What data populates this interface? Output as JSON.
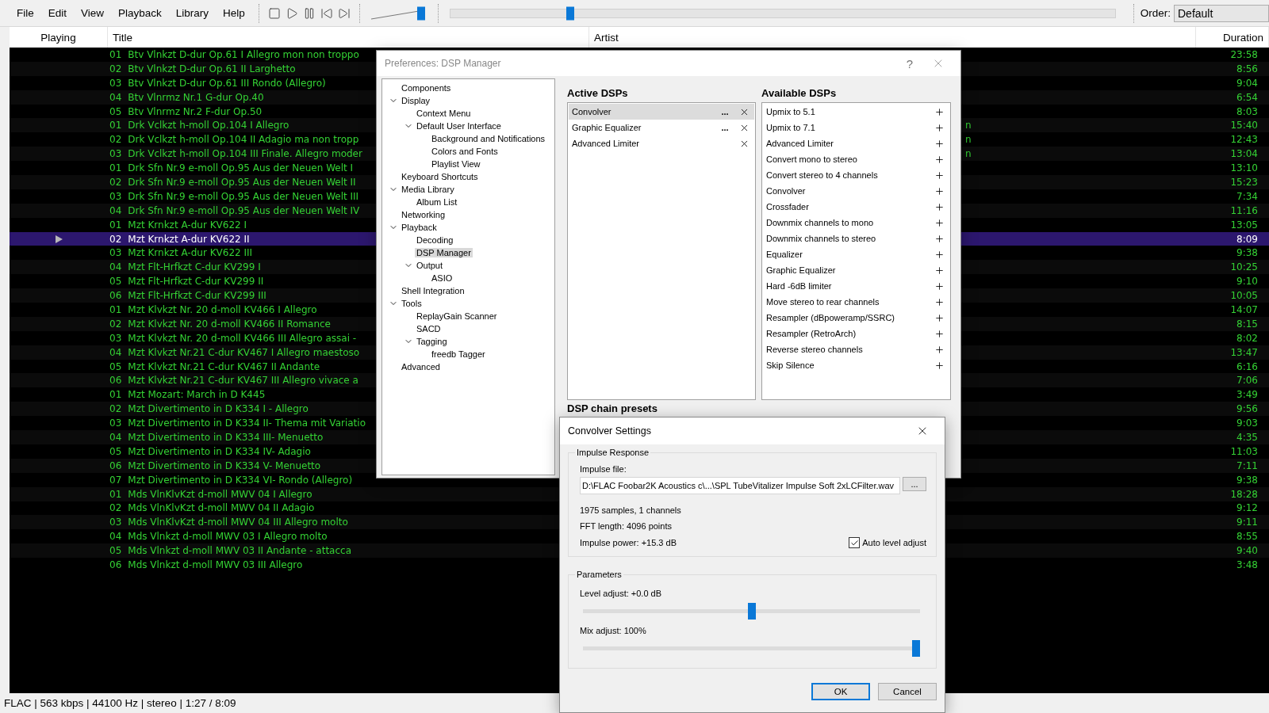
{
  "menu": [
    "File",
    "Edit",
    "View",
    "Playback",
    "Library",
    "Help"
  ],
  "toolbar": {
    "volume": {
      "level": 0.9
    },
    "seek": {
      "level": 0.18
    },
    "order_label": "Order:",
    "order_value": "Default"
  },
  "playlist": {
    "columns": [
      "Playing",
      "Title",
      "Artist",
      "Duration"
    ],
    "rows": [
      {
        "track": "01",
        "title": "Btv Vlnkzt D-dur Op.61 I Allegro mon non troppo",
        "duration": "23:58",
        "playing": false
      },
      {
        "track": "02",
        "title": "Btv Vlnkzt D-dur Op.61 II Larghetto",
        "duration": "8:56",
        "playing": false
      },
      {
        "track": "03",
        "title": "Btv Vlnkzt D-dur Op.61 III Rondo (Allegro)",
        "duration": "9:04",
        "playing": false
      },
      {
        "track": "04",
        "title": "Btv Vlnrmz Nr.1 G-dur Op.40",
        "duration": "6:54",
        "playing": false
      },
      {
        "track": "05",
        "title": "Btv Vlnrmz Nr.2 F-dur Op.50",
        "duration": "8:03",
        "playing": false
      },
      {
        "track": "01",
        "title": "Drk Vclkzt h-moll Op.104 I Allegro",
        "tail": "n",
        "duration": "15:40",
        "playing": false
      },
      {
        "track": "02",
        "title": "Drk Vclkzt h-moll Op.104 II Adagio ma non tropp",
        "tail": "n",
        "duration": "12:43",
        "playing": false
      },
      {
        "track": "03",
        "title": "Drk Vclkzt h-moll Op.104 III Finale. Allegro moder",
        "tail": "n",
        "duration": "13:04",
        "playing": false
      },
      {
        "track": "01",
        "title": "Drk Sfn Nr.9 e-moll Op.95 Aus der Neuen Welt I",
        "duration": "13:10",
        "playing": false
      },
      {
        "track": "02",
        "title": "Drk Sfn Nr.9 e-moll Op.95 Aus der Neuen Welt II",
        "duration": "15:23",
        "playing": false
      },
      {
        "track": "03",
        "title": "Drk Sfn Nr.9 e-moll Op.95 Aus der Neuen Welt III",
        "duration": "7:34",
        "playing": false
      },
      {
        "track": "04",
        "title": "Drk Sfn Nr.9 e-moll Op.95 Aus der Neuen Welt IV",
        "duration": "11:16",
        "playing": false
      },
      {
        "track": "01",
        "title": "Mzt Krnkzt A-dur KV622 I",
        "duration": "13:05",
        "playing": false
      },
      {
        "track": "02",
        "title": "Mzt Krnkzt A-dur KV622 II",
        "duration": "8:09",
        "playing": true
      },
      {
        "track": "03",
        "title": "Mzt Krnkzt A-dur KV622 III",
        "duration": "9:38",
        "playing": false
      },
      {
        "track": "04",
        "title": "Mzt Flt-Hrfkzt C-dur KV299 I",
        "duration": "10:25",
        "playing": false
      },
      {
        "track": "05",
        "title": "Mzt Flt-Hrfkzt C-dur KV299 II",
        "duration": "9:10",
        "playing": false
      },
      {
        "track": "06",
        "title": "Mzt Flt-Hrfkzt C-dur KV299 III",
        "duration": "10:05",
        "playing": false
      },
      {
        "track": "01",
        "title": "Mzt Klvkzt Nr. 20 d-moll KV466 I Allegro",
        "duration": "14:07",
        "playing": false
      },
      {
        "track": "02",
        "title": "Mzt Klvkzt Nr. 20 d-moll KV466 II Romance",
        "duration": "8:15",
        "playing": false
      },
      {
        "track": "03",
        "title": "Mzt Klvkzt Nr. 20 d-moll KV466 III Allegro assai -",
        "duration": "8:02",
        "playing": false
      },
      {
        "track": "04",
        "title": "Mzt Klvkzt Nr.21 C-dur KV467 I Allegro maestoso",
        "duration": "13:47",
        "playing": false
      },
      {
        "track": "05",
        "title": "Mzt Klvkzt Nr.21 C-dur KV467 II Andante",
        "duration": "6:16",
        "playing": false
      },
      {
        "track": "06",
        "title": "Mzt Klvkzt Nr.21 C-dur KV467 III Allegro vivace a",
        "duration": "7:06",
        "playing": false
      },
      {
        "track": "01",
        "title": "Mzt Mozart: March in D K445",
        "duration": "3:49",
        "playing": false
      },
      {
        "track": "02",
        "title": "Mzt Divertimento in D K334 I - Allegro",
        "duration": "9:56",
        "playing": false
      },
      {
        "track": "03",
        "title": "Mzt Divertimento in D K334 II- Thema mit Variatio",
        "duration": "9:03",
        "playing": false
      },
      {
        "track": "04",
        "title": "Mzt Divertimento in D K334 III- Menuetto",
        "duration": "4:35",
        "playing": false
      },
      {
        "track": "05",
        "title": "Mzt Divertimento in D K334 IV- Adagio",
        "duration": "11:03",
        "playing": false
      },
      {
        "track": "06",
        "title": "Mzt Divertimento in D K334 V- Menuetto",
        "duration": "7:11",
        "playing": false
      },
      {
        "track": "07",
        "title": "Mzt Divertimento in D K334 VI- Rondo (Allegro)",
        "duration": "9:38",
        "playing": false
      },
      {
        "track": "01",
        "title": "Mds VlnKlvKzt d-moll MWV 04 I Allegro",
        "duration": "18:28",
        "playing": false
      },
      {
        "track": "02",
        "title": "Mds VlnKlvKzt d-moll MWV 04 II Adagio",
        "duration": "9:12",
        "playing": false
      },
      {
        "track": "03",
        "title": "Mds VlnKlvKzt d-moll MWV 04 III Allegro molto",
        "duration": "9:11",
        "playing": false
      },
      {
        "track": "04",
        "title": "Mds Vlnkzt d-moll MWV 03 I Allegro molto",
        "duration": "8:55",
        "playing": false
      },
      {
        "track": "05",
        "title": "Mds Vlnkzt d-moll MWV 03 II Andante - attacca",
        "duration": "9:40",
        "playing": false
      },
      {
        "track": "06",
        "title": "Mds Vlnkzt d-moll MWV 03 III Allegro",
        "duration": "3:48",
        "playing": false
      }
    ]
  },
  "preferences": {
    "title": "Preferences: DSP Manager",
    "help": "?",
    "tree": [
      {
        "label": "Components",
        "selected": false
      },
      {
        "label": "Display",
        "selected": false,
        "expanded": true,
        "children": [
          {
            "label": "Context Menu",
            "selected": false
          },
          {
            "label": "Default User Interface",
            "selected": false,
            "expanded": true,
            "children": [
              {
                "label": "Background and Notifications",
                "selected": false
              },
              {
                "label": "Colors and Fonts",
                "selected": false
              },
              {
                "label": "Playlist View",
                "selected": false
              }
            ]
          }
        ]
      },
      {
        "label": "Keyboard Shortcuts",
        "selected": false
      },
      {
        "label": "Media Library",
        "selected": false,
        "expanded": true,
        "children": [
          {
            "label": "Album List",
            "selected": false
          }
        ]
      },
      {
        "label": "Networking",
        "selected": false
      },
      {
        "label": "Playback",
        "selected": false,
        "expanded": true,
        "children": [
          {
            "label": "Decoding",
            "selected": false
          },
          {
            "label": "DSP Manager",
            "selected": true
          },
          {
            "label": "Output",
            "selected": false,
            "expanded": true,
            "children": [
              {
                "label": "ASIO",
                "selected": false
              }
            ]
          }
        ]
      },
      {
        "label": "Shell Integration",
        "selected": false
      },
      {
        "label": "Tools",
        "selected": false,
        "expanded": true,
        "children": [
          {
            "label": "ReplayGain Scanner",
            "selected": false
          },
          {
            "label": "SACD",
            "selected": false
          },
          {
            "label": "Tagging",
            "selected": false,
            "expanded": true,
            "children": [
              {
                "label": "freedb Tagger",
                "selected": false
              }
            ]
          }
        ]
      },
      {
        "label": "Advanced",
        "selected": false
      }
    ],
    "active_heading": "Active DSPs",
    "active": [
      {
        "name": "Convolver",
        "config_button": "...",
        "selected": true
      },
      {
        "name": "Graphic Equalizer",
        "config_button": "...",
        "selected": false
      },
      {
        "name": "Advanced Limiter",
        "selected": false
      }
    ],
    "available_heading": "Available DSPs",
    "available": [
      "Upmix to 5.1",
      "Upmix to 7.1",
      "Advanced Limiter",
      "Convert mono to stereo",
      "Convert stereo to 4 channels",
      "Convolver",
      "Crossfader",
      "Downmix channels to mono",
      "Downmix channels to stereo",
      "Equalizer",
      "Graphic Equalizer",
      "Hard -6dB limiter",
      "Move stereo to rear channels",
      "Resampler (dBpoweramp/SSRC)",
      "Resampler (RetroArch)",
      "Reverse stereo channels",
      "Skip Silence"
    ],
    "presets_heading": "DSP chain presets"
  },
  "convolver": {
    "title": "Convolver Settings",
    "impulse_group": "Impulse Response",
    "file_label": "Impulse file:",
    "file_path": "D:\\FLAC Foobar2K Acoustics c\\...\\SPL TubeVitalizer Impulse Soft 2xLCFilter.wav",
    "browse": "...",
    "info": [
      "1975 samples, 1 channels",
      "FFT length: 4096 points",
      "Impulse power: +15.3 dB"
    ],
    "auto_level": {
      "label": "Auto level adjust",
      "checked": true
    },
    "parameters_group": "Parameters",
    "sliders": [
      {
        "label": "Level adjust: +0.0 dB",
        "level": 0.5
      },
      {
        "label": "Mix adjust: 100%",
        "level": 1
      }
    ],
    "buttons": [
      {
        "label": "OK",
        "default": true
      },
      {
        "label": "Cancel",
        "default": false
      }
    ]
  },
  "status_bar": "FLAC | 563 kbps | 44100 Hz | stereo | 1:27 / 8:09"
}
